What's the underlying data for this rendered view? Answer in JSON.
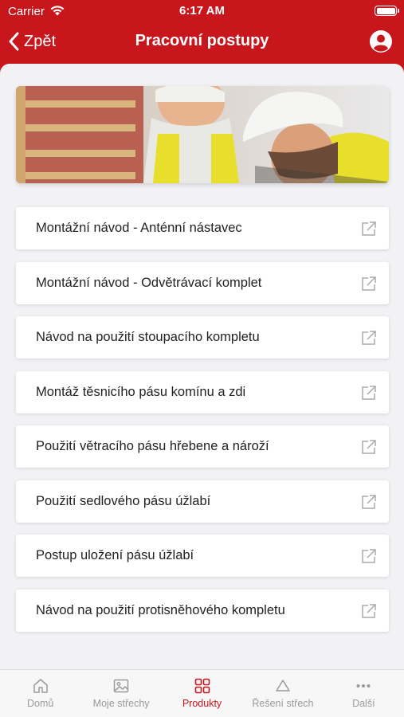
{
  "status_bar": {
    "carrier": "Carrier",
    "time": "6:17 AM"
  },
  "header": {
    "back_label": "Zpět",
    "title": "Pracovní postupy"
  },
  "colors": {
    "brand_red": "#c8161d",
    "background": "#f2f2f5",
    "inactive_tab": "#9a9a9a"
  },
  "hero": {
    "description_icon": "workers-photo"
  },
  "items": [
    {
      "label": "Montážní návod - Anténní nástavec",
      "icon": "external-link-icon"
    },
    {
      "label": "Montážní návod - Odvětrávací komplet",
      "icon": "external-link-icon"
    },
    {
      "label": "Návod na použití stoupacího kompletu",
      "icon": "external-link-icon"
    },
    {
      "label": "Montáž těsnicího pásu komínu a zdi",
      "icon": "external-link-icon"
    },
    {
      "label": "Použití větracího pásu hřebene a nároží",
      "icon": "external-link-icon"
    },
    {
      "label": "Použití sedlového pásu úžlabí",
      "icon": "external-link-icon"
    },
    {
      "label": "Postup uložení pásu úžlabí",
      "icon": "external-link-icon"
    },
    {
      "label": "Návod na použití protisněhového kompletu",
      "icon": "external-link-icon"
    }
  ],
  "tabs": [
    {
      "label": "Domů",
      "icon": "home-icon",
      "active": false
    },
    {
      "label": "Moje střechy",
      "icon": "image-icon",
      "active": false
    },
    {
      "label": "Produkty",
      "icon": "grid-icon",
      "active": true
    },
    {
      "label": "Řešení střech",
      "icon": "triangle-icon",
      "active": false
    },
    {
      "label": "Další",
      "icon": "more-icon",
      "active": false
    }
  ]
}
